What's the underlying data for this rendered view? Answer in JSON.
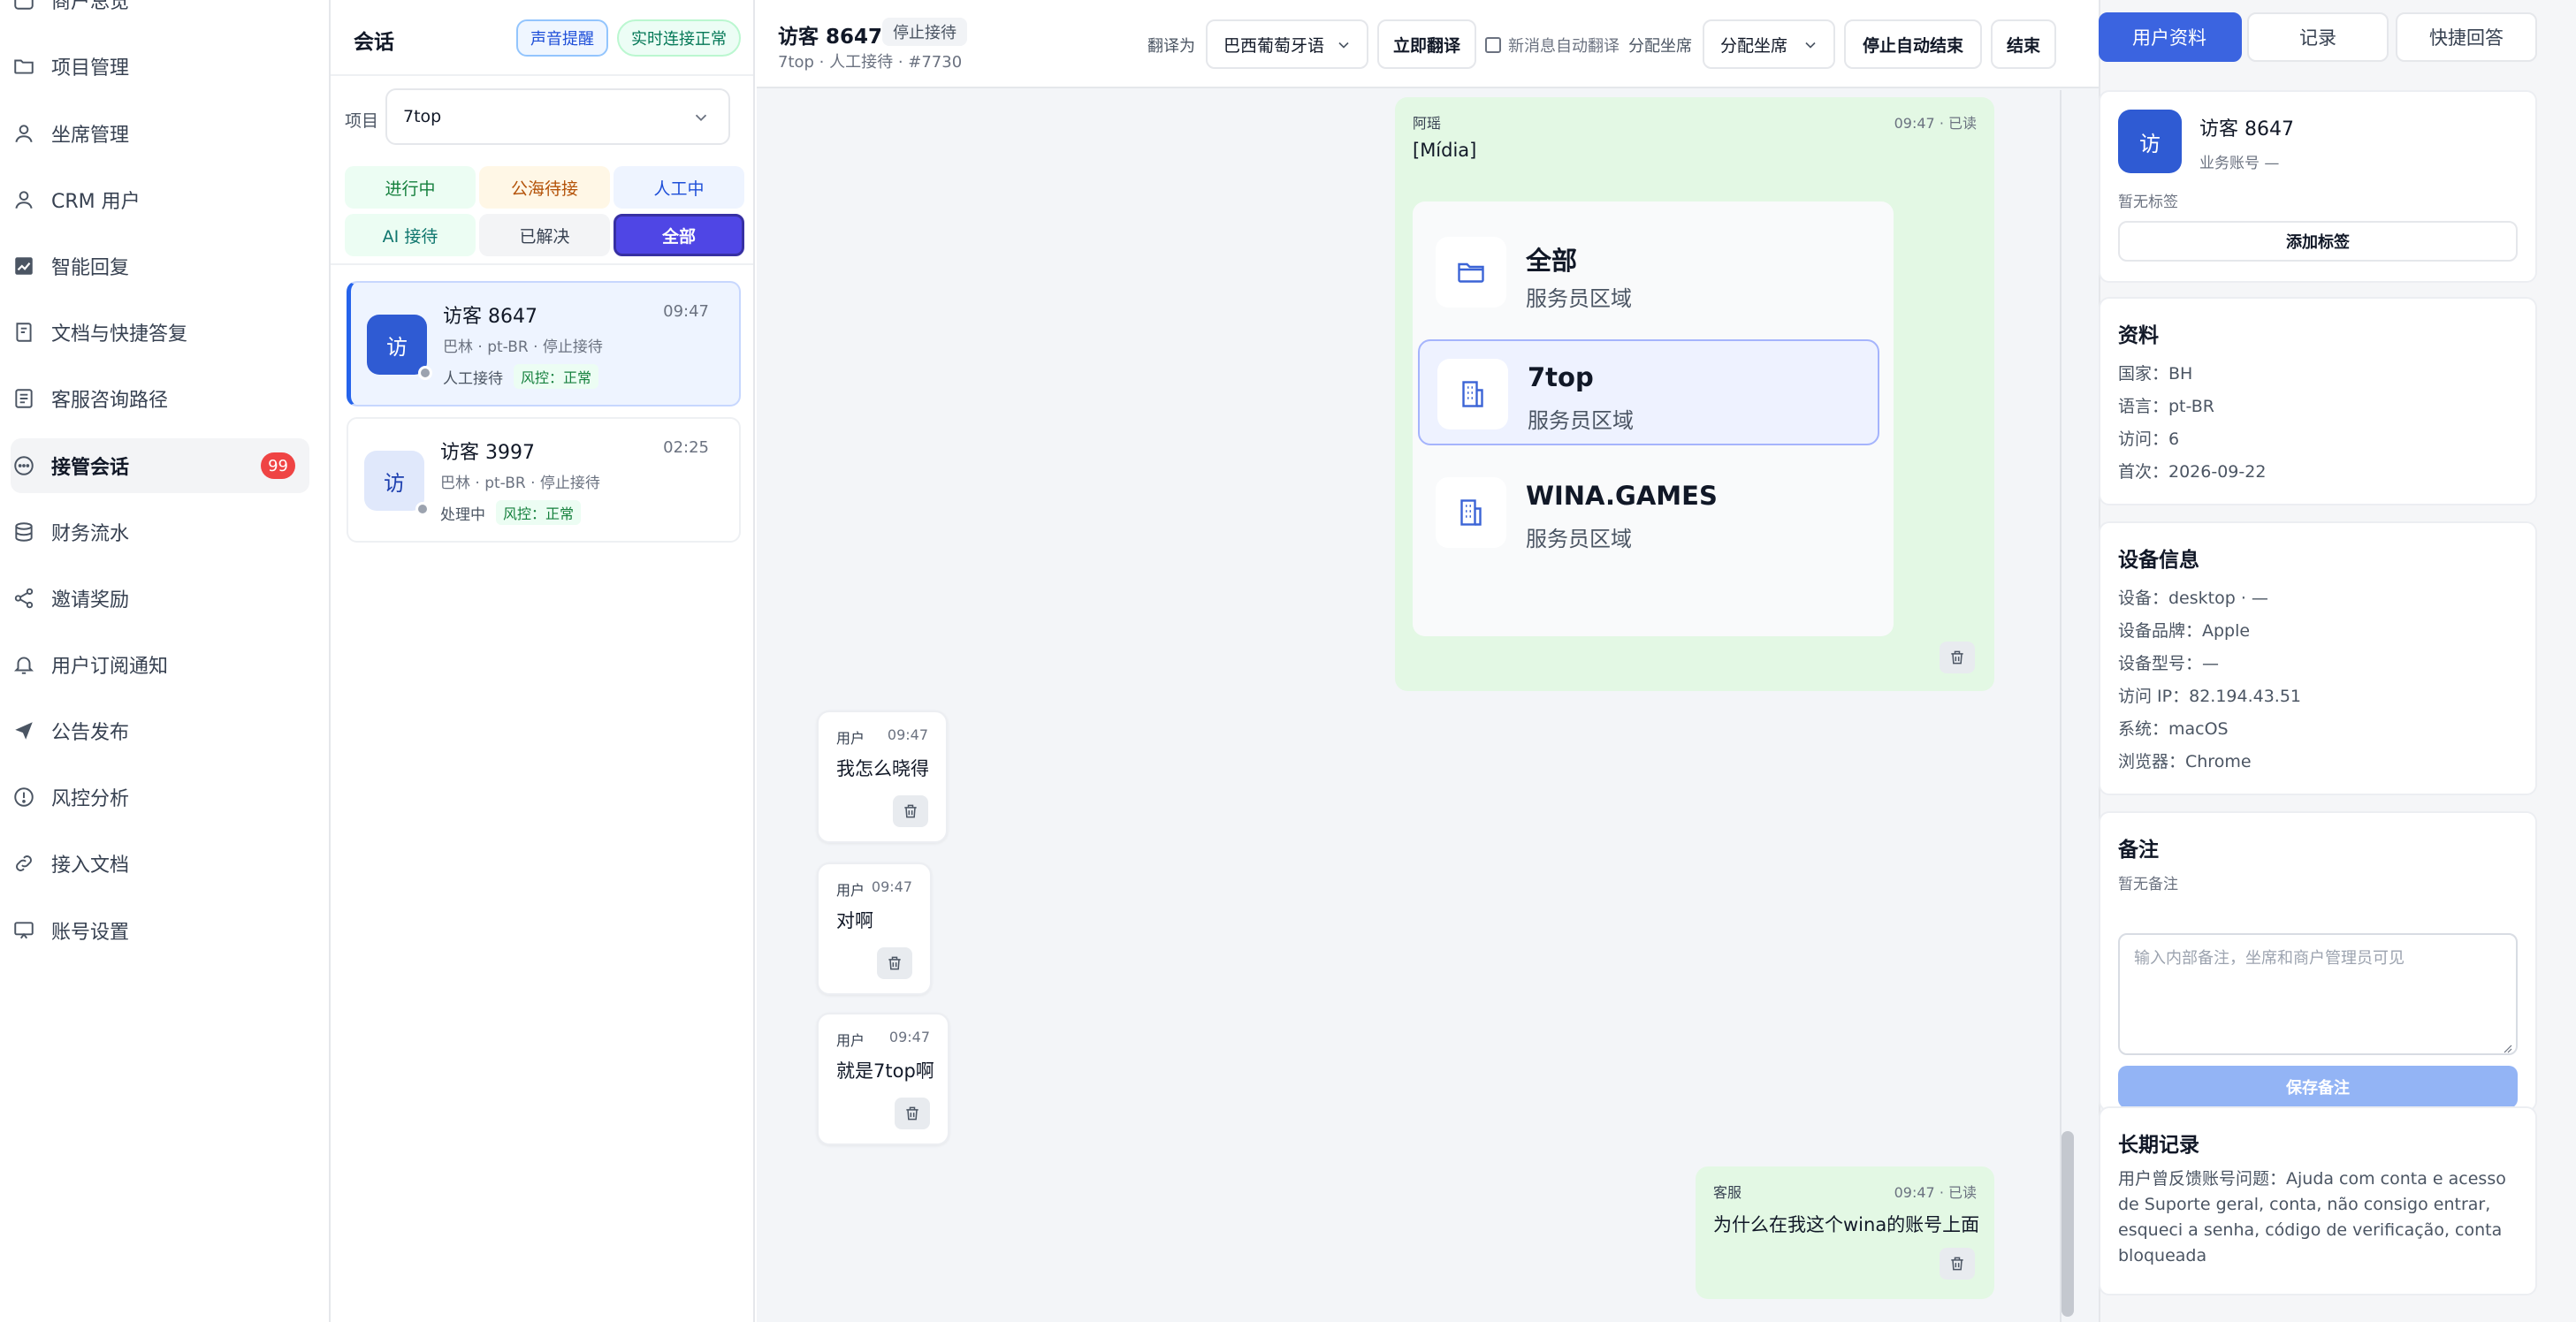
{
  "nav": {
    "items": [
      {
        "label": "商户总览",
        "icon": "home-icon"
      },
      {
        "label": "项目管理",
        "icon": "folder-icon"
      },
      {
        "label": "坐席管理",
        "icon": "user-icon"
      },
      {
        "label": "CRM 用户",
        "icon": "user-icon"
      },
      {
        "label": "智能回复",
        "icon": "chart-icon"
      },
      {
        "label": "文档与快捷答复",
        "icon": "book-icon"
      },
      {
        "label": "客服咨询路径",
        "icon": "document-icon"
      },
      {
        "label": "接管会话",
        "icon": "chat-icon",
        "badge": "99",
        "active": true
      },
      {
        "label": "财务流水",
        "icon": "database-icon"
      },
      {
        "label": "邀请奖励",
        "icon": "share-icon"
      },
      {
        "label": "用户订阅通知",
        "icon": "bell-icon"
      },
      {
        "label": "公告发布",
        "icon": "send-icon"
      },
      {
        "label": "风控分析",
        "icon": "alert-icon"
      },
      {
        "label": "接入文档",
        "icon": "link-icon"
      },
      {
        "label": "账号设置",
        "icon": "monitor-icon"
      }
    ]
  },
  "convs": {
    "title": "会话",
    "sound": "声音提醒",
    "live": "实时连接正常",
    "project_label": "项目",
    "project_value": "7top",
    "filters": {
      "ongoing": "进行中",
      "sea": "公海待接",
      "manual": "人工中",
      "ai": "AI 接待",
      "resolved": "已解决",
      "all": "全部"
    },
    "list": [
      {
        "avatar": "访",
        "name": "访客 8647",
        "time": "09:47",
        "meta": "巴林 · pt-BR · 停止接待",
        "status": "人工接待",
        "risk": "风控：正常"
      },
      {
        "avatar": "访",
        "name": "访客 3997",
        "time": "02:25",
        "meta": "巴林 · pt-BR · 停止接待",
        "status": "处理中",
        "risk": "风控：正常"
      }
    ]
  },
  "chat": {
    "name": "访客 8647",
    "state": "停止接待",
    "sub": "7top · 人工接待 · #7730",
    "translate_label": "翻译为",
    "translate_value": "巴西葡萄牙语",
    "translate_now": "立即翻译",
    "auto_translate": "新消息自动翻译",
    "assign_label": "分配坐席",
    "assign_value": "分配坐席",
    "stop_auto": "停止自动结束",
    "end": "结束",
    "messages": {
      "m1": {
        "sender": "阿瑶",
        "time": "09:47 · 已读",
        "text": "[Mídia]",
        "items": [
          {
            "title": "全部",
            "sub": "服务员区域",
            "icon": "folder-icon"
          },
          {
            "title": "7top",
            "sub": "服务员区域",
            "icon": "building-icon"
          },
          {
            "title": "WINA.GAMES",
            "sub": "服务员区域",
            "icon": "building-icon"
          }
        ]
      },
      "m2": {
        "sender": "用户",
        "time": "09:47",
        "text": "我怎么晓得"
      },
      "m3": {
        "sender": "用户",
        "time": "09:47",
        "text": "对啊"
      },
      "m4": {
        "sender": "用户",
        "time": "09:47",
        "text": "就是7top啊"
      },
      "m5": {
        "sender": "客服",
        "time": "09:47 · 已读",
        "text": "为什么在我这个wina的账号上面"
      }
    }
  },
  "side": {
    "tabs": {
      "profile": "用户资料",
      "records": "记录",
      "quick": "快捷回答"
    },
    "user": {
      "avatar": "访",
      "name": "访客 8647",
      "account": "业务账号 —",
      "no_tag": "暂无标签",
      "add_tag": "添加标签"
    },
    "info": {
      "title": "资料",
      "rows": [
        "国家：BH",
        "语言：pt-BR",
        "访问：6",
        "首次：2026-09-22"
      ]
    },
    "device": {
      "title": "设备信息",
      "rows": [
        "设备：desktop · —",
        "设备品牌：Apple",
        "设备型号：—",
        "访问 IP：82.194.43.51",
        "系统：macOS",
        "浏览器：Chrome"
      ]
    },
    "note": {
      "title": "备注",
      "empty": "暂无备注",
      "placeholder": "输入内部备注，坐席和商户管理员可见",
      "save": "保存备注"
    },
    "long": {
      "title": "长期记录",
      "text": "用户曾反馈账号问题：Ajuda com conta e acesso de Suporte geral, conta, não consigo entrar, esqueci a senha, código de verificação, conta bloqueada"
    }
  },
  "colors": {
    "accent": "#3b64e0",
    "active_filter": "#4f46e5",
    "agent_bubble": "#e3f8e4",
    "badge": "#ef4444"
  }
}
